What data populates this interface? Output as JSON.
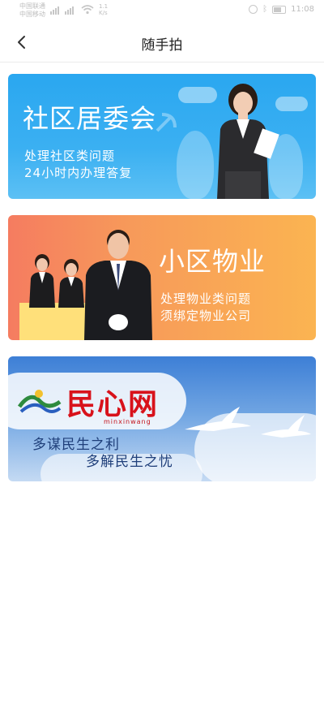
{
  "status_bar": {
    "carrier_1": "中国联通",
    "carrier_2": "中国移动",
    "net": "1.1\nK/s",
    "time": "11:08"
  },
  "header": {
    "title": "随手拍"
  },
  "cards": [
    {
      "title": "社区居委会",
      "line1": "处理社区类问题",
      "line2": "24小时内办理答复"
    },
    {
      "title": "小区物业",
      "line1": "处理物业类问题",
      "line2": "须绑定物业公司"
    },
    {
      "brand": "民心网",
      "brand_sub": "minxinwang",
      "line1": "多谋民生之利",
      "line2": "多解民生之忧"
    }
  ]
}
